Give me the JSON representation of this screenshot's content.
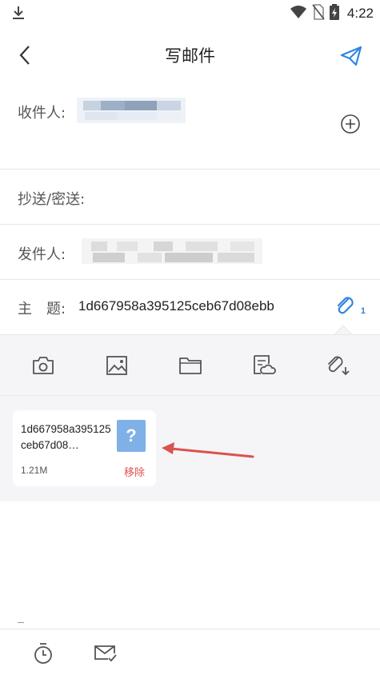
{
  "status_bar": {
    "time": "4:22",
    "icons": [
      "download-icon",
      "wifi-icon",
      "no-sim-icon",
      "battery-charging-icon"
    ]
  },
  "header": {
    "title": "写邮件",
    "back_icon": "chevron-left-icon",
    "send_icon": "paper-plane-icon"
  },
  "form": {
    "to_label": "收件人:",
    "cc_bcc_label": "抄送/密送:",
    "from_label": "发件人:",
    "subject_label": "主　题:",
    "subject_value": "1d667958a395125ceb67d08ebb",
    "attachment_count": "1"
  },
  "attach_toolbar": {
    "tools": [
      "camera-icon",
      "image-icon",
      "folder-icon",
      "cloud-file-icon",
      "attachment-download-icon"
    ]
  },
  "attachments": [
    {
      "name": "1d667958a395125ceb67d08…",
      "size": "1.21M",
      "remove_label": "移除",
      "icon_glyph": "?"
    }
  ],
  "bottom_bar": {
    "tools": [
      "timer-icon",
      "mail-check-icon"
    ]
  },
  "colors": {
    "accent": "#2f86e0",
    "remove": "#e05050",
    "panel_bg": "#f5f5f7",
    "annotation_arrow": "#d9534f"
  }
}
